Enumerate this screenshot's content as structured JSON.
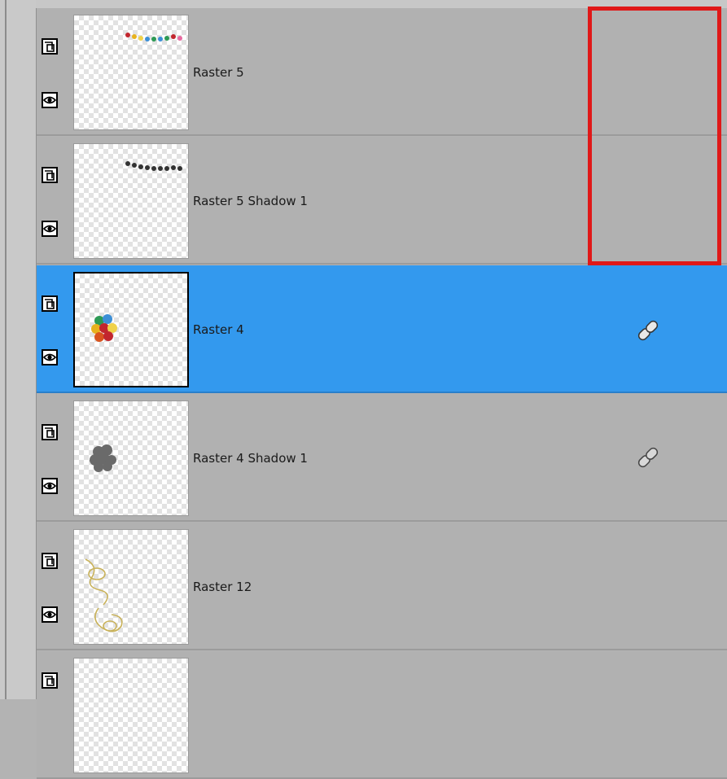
{
  "layers": [
    {
      "name": "Raster 5",
      "selected": false,
      "linked": false,
      "toggle_icon": "layer-mask-icon",
      "visibility_icon": "eye-icon"
    },
    {
      "name": "Raster 5 Shadow 1",
      "selected": false,
      "linked": false,
      "toggle_icon": "layer-mask-icon",
      "visibility_icon": "eye-icon"
    },
    {
      "name": "Raster 4",
      "selected": true,
      "linked": true,
      "link_icon": "chain-link-icon",
      "toggle_icon": "layer-mask-icon",
      "visibility_icon": "eye-icon"
    },
    {
      "name": "Raster 4 Shadow 1",
      "selected": false,
      "linked": true,
      "link_icon": "chain-link-icon",
      "toggle_icon": "layer-mask-icon",
      "visibility_icon": "eye-icon"
    },
    {
      "name": "Raster 12",
      "selected": false,
      "linked": false,
      "toggle_icon": "layer-mask-icon",
      "visibility_icon": "eye-icon"
    },
    {
      "name": "",
      "selected": false,
      "linked": false,
      "toggle_icon": "layer-mask-icon"
    }
  ],
  "colors": {
    "panel_bg": "#b1b1b1",
    "selection": "#3399ee",
    "highlight_box": "#e01818"
  }
}
